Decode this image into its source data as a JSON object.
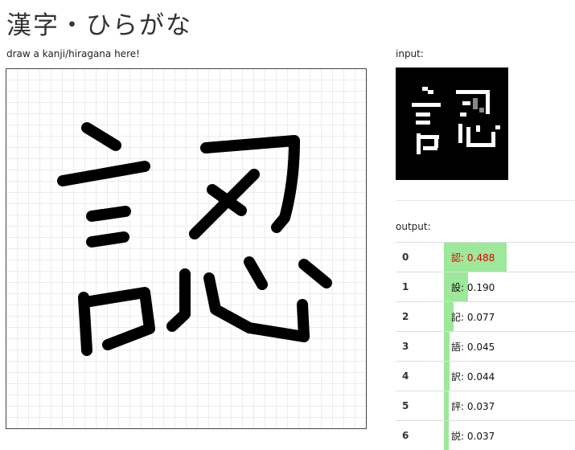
{
  "title": "漢字・ひらがな",
  "canvas": {
    "label": "draw a kanji/hiragana here!"
  },
  "input": {
    "label": "input:"
  },
  "output": {
    "label": "output:",
    "results": [
      {
        "rank": "0",
        "char": "認",
        "score": "0.488",
        "value": 0.488
      },
      {
        "rank": "1",
        "char": "設",
        "score": "0.190",
        "value": 0.19
      },
      {
        "rank": "2",
        "char": "記",
        "score": "0.077",
        "value": 0.077
      },
      {
        "rank": "3",
        "char": "語",
        "score": "0.045",
        "value": 0.045
      },
      {
        "rank": "4",
        "char": "訳",
        "score": "0.044",
        "value": 0.044
      },
      {
        "rank": "5",
        "char": "評",
        "score": "0.037",
        "value": 0.037
      },
      {
        "rank": "6",
        "char": "説",
        "score": "0.037",
        "value": 0.037
      }
    ]
  }
}
